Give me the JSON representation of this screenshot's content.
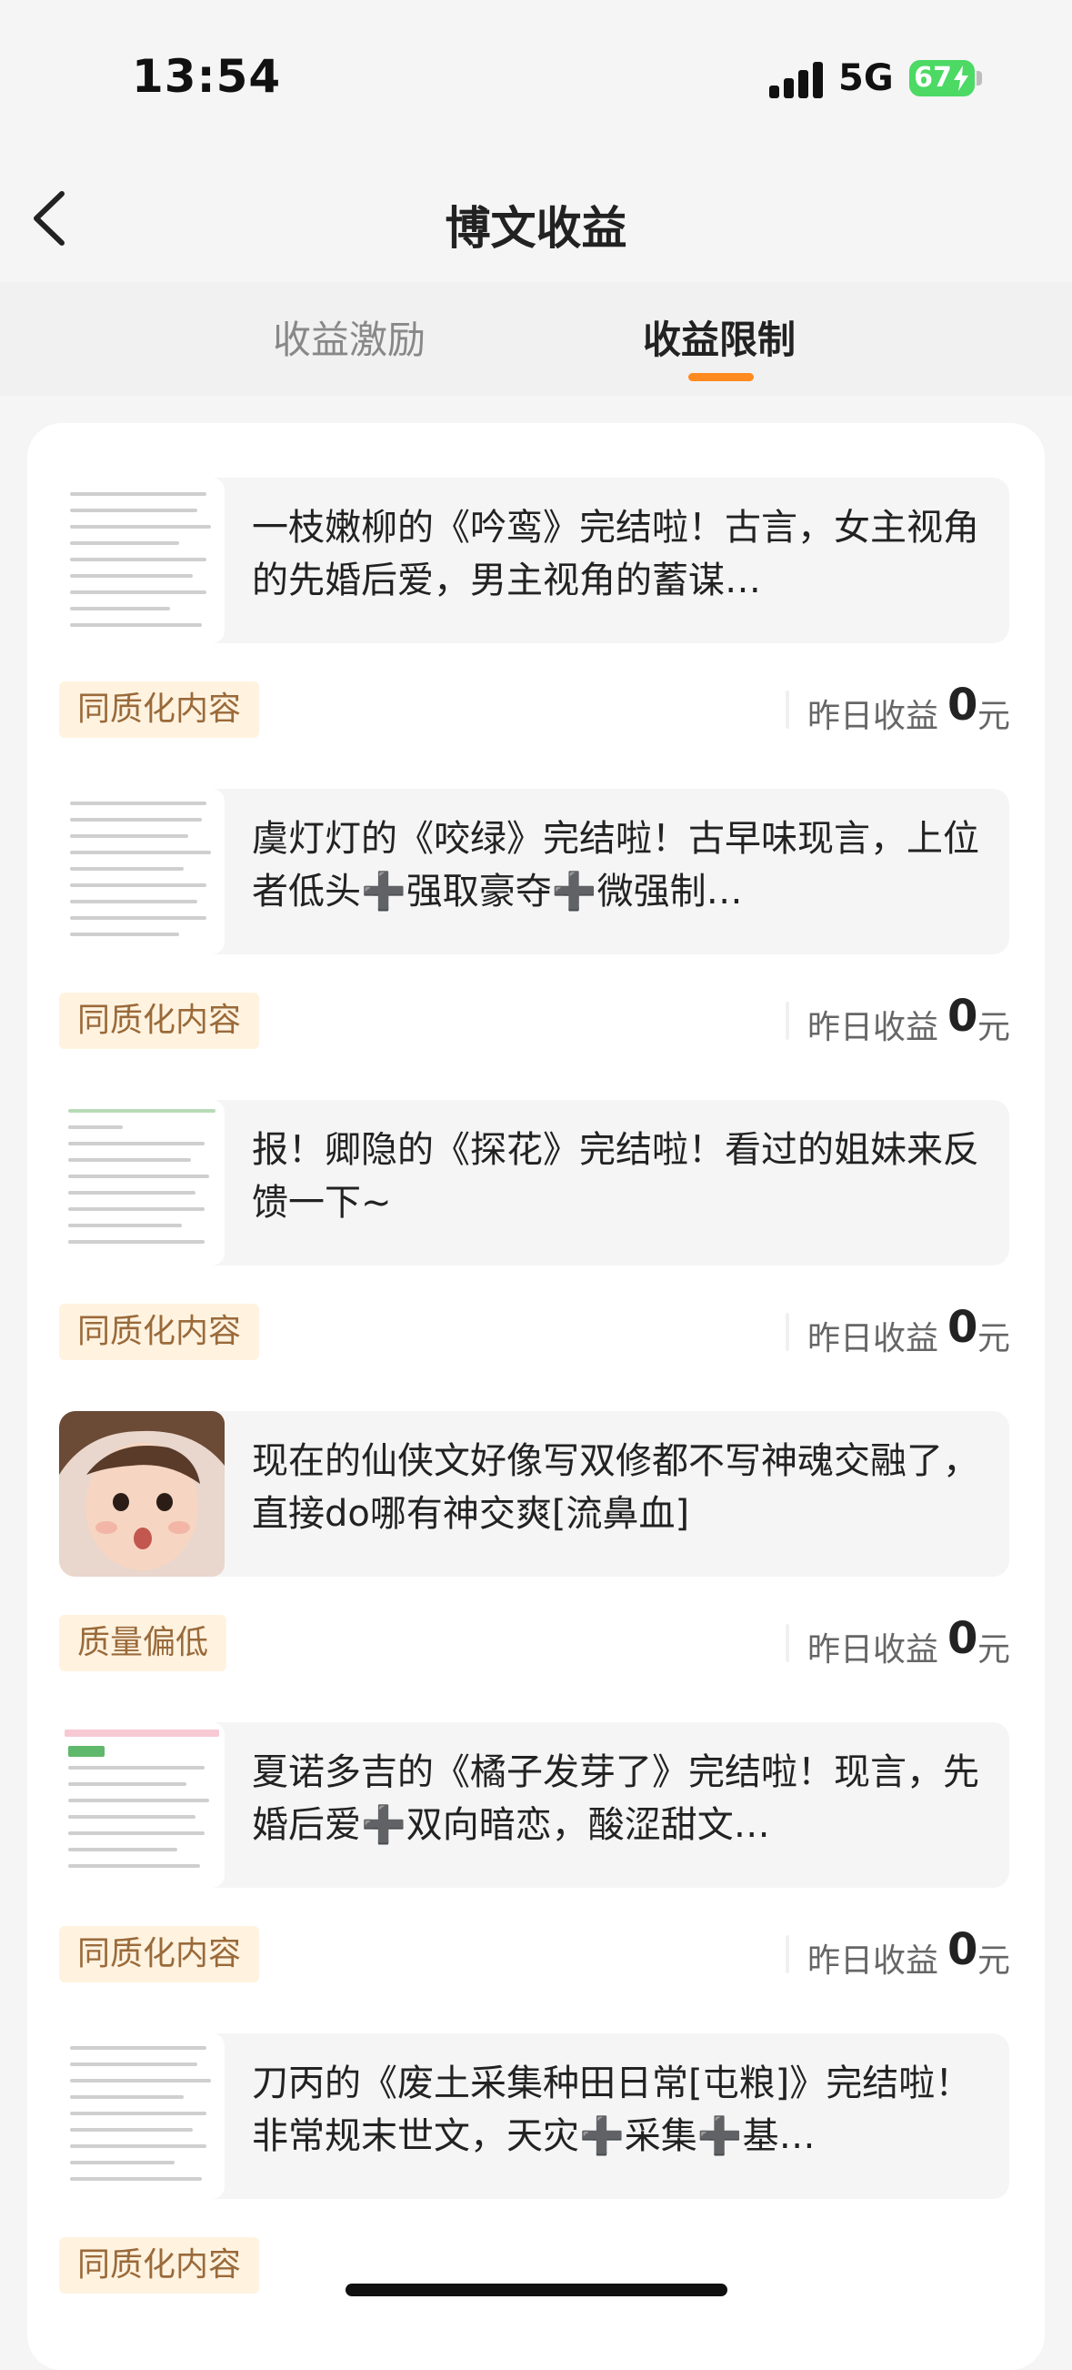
{
  "status": {
    "time": "13:54",
    "network": "5G",
    "battery": "67"
  },
  "nav": {
    "title": "博文收益"
  },
  "tabs": [
    {
      "label": "收益激励"
    },
    {
      "label": "收益限制"
    }
  ],
  "earn_label": "昨日收益",
  "earn_unit": "元",
  "items": [
    {
      "text": "一枝嫩柳的《吟鸾》完结啦！古言，女主视角的先婚后爱，男主视角的蓄谋…",
      "tag": "同质化内容",
      "earn": "0"
    },
    {
      "text": "虞灯灯的《咬绿》完结啦！古早味现言，上位者低头➕强取豪夺➕微强制…",
      "tag": "同质化内容",
      "earn": "0"
    },
    {
      "text": "报！卿隐的《探花》完结啦！看过的姐妹来反馈一下~",
      "tag": "同质化内容",
      "earn": "0"
    },
    {
      "text": "现在的仙侠文好像写双修都不写神魂交融了，直接do哪有神交爽[流鼻血]",
      "tag": "质量偏低",
      "earn": "0"
    },
    {
      "text": "夏诺多吉的《橘子发芽了》完结啦！现言，先婚后爱➕双向暗恋，酸涩甜文…",
      "tag": "同质化内容",
      "earn": "0"
    },
    {
      "text": "刀丙的《废土采集种田日常[屯粮]》完结啦！非常规末世文，天灾➕采集➕基…",
      "tag": "同质化内容",
      "earn": ""
    }
  ]
}
